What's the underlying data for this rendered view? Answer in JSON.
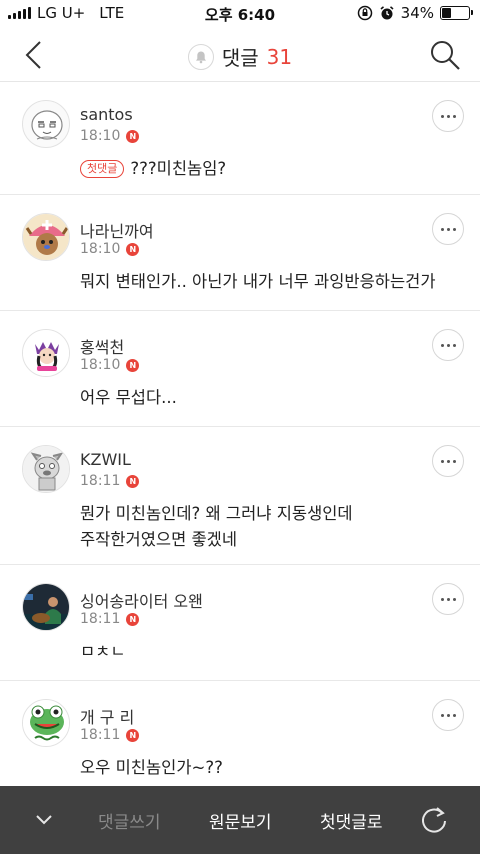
{
  "status": {
    "carrier": "LG U+",
    "network": "LTE",
    "time": "오후 6:40",
    "battery_text": "34%",
    "battery_level": 0.34
  },
  "header": {
    "title": "댓글",
    "count": "31",
    "icons": [
      "back-icon",
      "bell-icon",
      "search-icon"
    ]
  },
  "comments": [
    {
      "name": "santos",
      "time": "18:10",
      "new": "N",
      "badge": "첫댓글",
      "text": "???미친놈임?"
    },
    {
      "name": "나라닌까여",
      "time": "18:10",
      "new": "N",
      "badge": "",
      "text": "뭐지 변태인가.. 아닌가 내가 너무 과잉반응하는건가"
    },
    {
      "name": "홍썩천",
      "time": "18:10",
      "new": "N",
      "badge": "",
      "text": "어우 무섭다..."
    },
    {
      "name": "KZWIL",
      "time": "18:11",
      "new": "N",
      "badge": "",
      "text": "뭔가 미친놈인데? 왜 그러냐 지동생인데\n주작한거였으면 좋겠네"
    },
    {
      "name": "싱어송라이터 오왠",
      "time": "18:11",
      "new": "N",
      "badge": "",
      "text": "ㅁㅊㄴ"
    },
    {
      "name": "개 구 리",
      "time": "18:11",
      "new": "N",
      "badge": "",
      "text": "오우 미친놈인가~??"
    }
  ],
  "bottom_bar": {
    "write": "댓글쓰기",
    "original": "원문보기",
    "first": "첫댓글로",
    "icons": [
      "chevron-down-icon",
      "refresh-icon"
    ]
  },
  "colors": {
    "accent": "#e8443a",
    "bottom_bar": "#404040"
  }
}
